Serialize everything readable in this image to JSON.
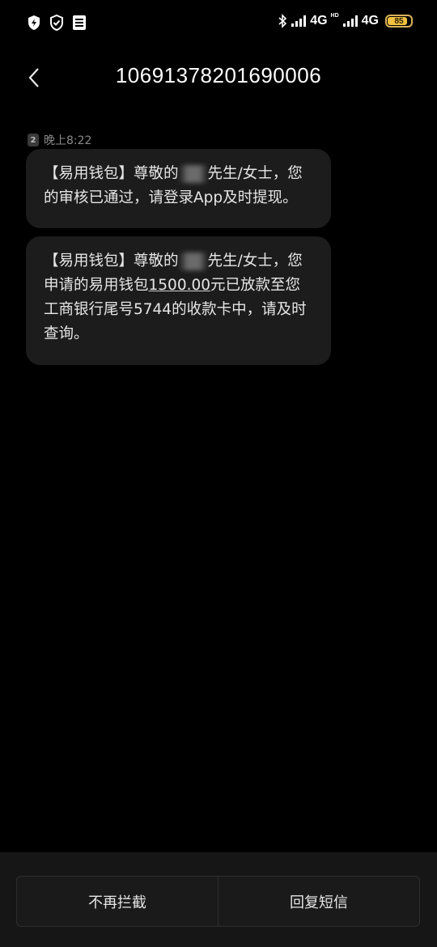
{
  "status_bar": {
    "network_1": "4G",
    "network_2_badge": "HD",
    "network_2": "4G",
    "battery_level": "85",
    "icons": [
      "shield-lightning-icon",
      "shield-check-icon",
      "sim-card-icon",
      "bluetooth-icon",
      "signal-icon",
      "signal-icon",
      "battery-icon"
    ]
  },
  "header": {
    "title": "10691378201690006"
  },
  "conversation": {
    "sim_slot": "2",
    "timestamp": "晚上8:22",
    "messages": [
      {
        "part1": "【易用钱包】尊敬的",
        "part2": "先生/女士，您的审核已通过，请登录App及时提现。"
      },
      {
        "part1": "【易用钱包】尊敬的",
        "part2": "先生/女士，您申请的易用钱包",
        "amount": "1500.00",
        "part3": "元已放款至您工商银行尾号5744的收款卡中，请及时查询。"
      }
    ]
  },
  "bottom_actions": {
    "unblock_label": "不再拦截",
    "reply_label": "回复短信"
  },
  "colors": {
    "background": "#000000",
    "bubble": "#1c1c1c",
    "bottom_bar": "#161616",
    "battery": "#f0c040"
  }
}
